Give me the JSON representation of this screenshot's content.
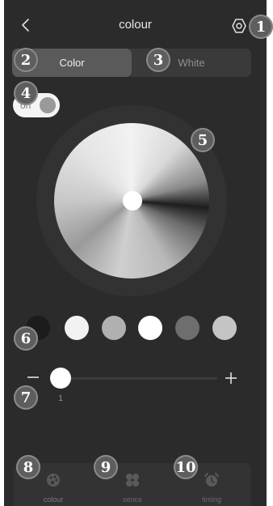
{
  "header": {
    "title": "colour",
    "back_icon": "chevron-left-icon",
    "settings_icon": "hexagon-settings-icon"
  },
  "tabs": [
    {
      "label": "Color",
      "active": true
    },
    {
      "label": "White",
      "active": false
    }
  ],
  "power_toggle": {
    "label": "on",
    "state": true
  },
  "color_wheel": {
    "selected_color": "#ffffff"
  },
  "swatches": [
    {
      "color": "#1c1c1c",
      "selected": true
    },
    {
      "color": "#f2f2f2",
      "selected": false
    },
    {
      "color": "#b0b0b0",
      "selected": false
    },
    {
      "color": "#ffffff",
      "selected": false
    },
    {
      "color": "#6e6e6e",
      "selected": false
    },
    {
      "color": "#c4c4c4",
      "selected": false
    }
  ],
  "brightness": {
    "minus_symbol": "−",
    "plus_symbol": "+",
    "value": "1",
    "fraction": 0.0
  },
  "bottom_nav": [
    {
      "label": "colour",
      "icon": "palette-icon",
      "active": true
    },
    {
      "label": "sence",
      "icon": "clover-icon",
      "active": false
    },
    {
      "label": "timing",
      "icon": "alarm-clock-icon",
      "active": false
    }
  ],
  "annotations": [
    "1",
    "2",
    "3",
    "4",
    "5",
    "6",
    "7",
    "8",
    "9",
    "10"
  ]
}
